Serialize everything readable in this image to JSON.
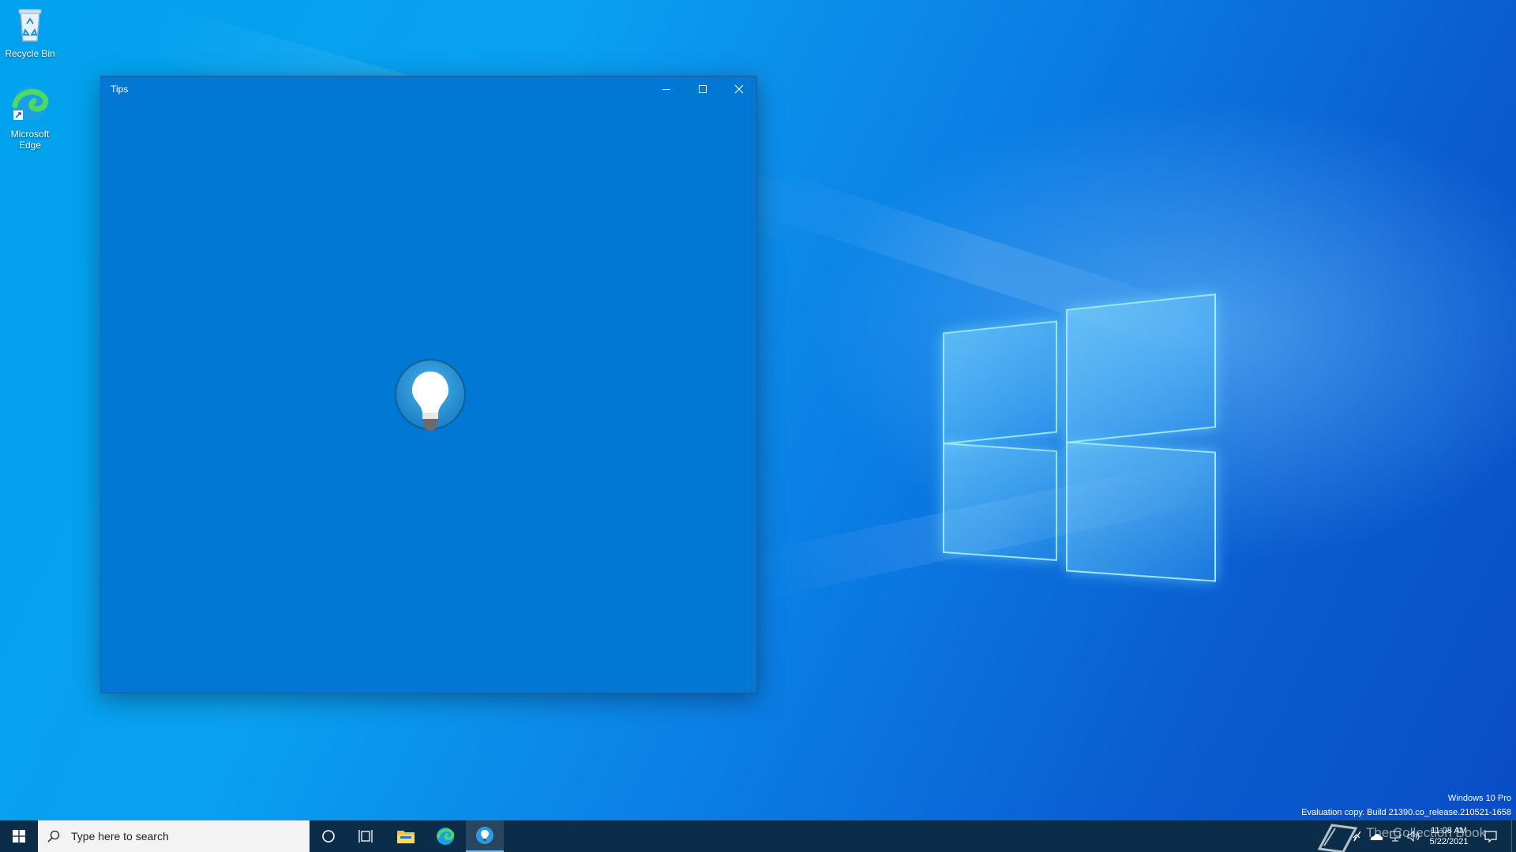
{
  "desktop": {
    "icons": [
      {
        "label": "Recycle Bin",
        "icon": "recycle-bin-icon"
      },
      {
        "label": "Microsoft Edge",
        "icon": "edge-icon"
      }
    ],
    "watermark": {
      "edition": "Windows 10 Pro",
      "build": "Evaluation copy. Build 21390.co_release.210521-1658"
    }
  },
  "window": {
    "title": "Tips",
    "controls": [
      "minimize-icon",
      "maximize-icon",
      "close-icon"
    ],
    "splash_icon": "lightbulb-icon",
    "background": "#0078d4"
  },
  "taskbar": {
    "start_icon": "windows-start-icon",
    "search_placeholder": "Type here to search",
    "pinned": [
      "cortana-icon",
      "task-view-icon",
      "file-explorer-icon",
      "edge-icon",
      "tips-icon"
    ],
    "active_app": "Tips",
    "tray": {
      "overlay_text": "The Collection Book",
      "time": "11:08 AM",
      "date": "5/22/2021"
    },
    "color": "#0b2d4a"
  }
}
